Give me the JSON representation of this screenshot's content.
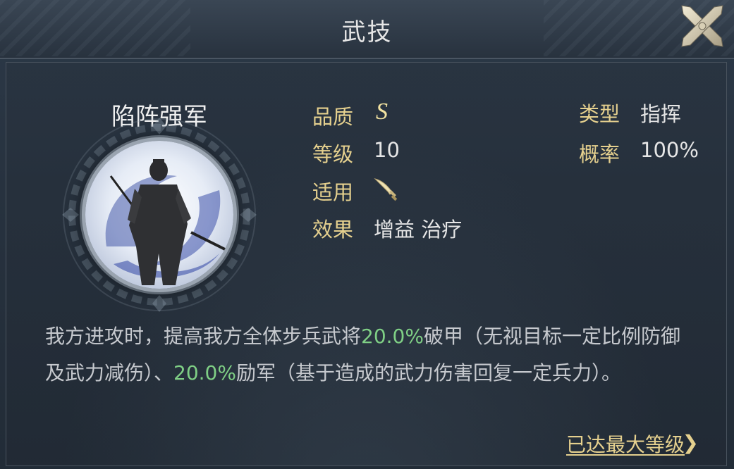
{
  "window": {
    "title": "武技"
  },
  "skill": {
    "name": "陷阵强军",
    "quality_label": "品质",
    "quality": "S",
    "level_label": "等级",
    "level": "10",
    "applies_label": "适用",
    "applies_icon": "sword-icon",
    "effect_label": "效果",
    "effect": "增益 治疗",
    "type_label": "类型",
    "type": "指挥",
    "rate_label": "概率",
    "rate": "100%"
  },
  "description": {
    "part1": "我方进攻时，提高我方全体步兵武将",
    "value1": "20.0%",
    "part2": "破甲（无视目标一定比例防御及武力减伤）、",
    "value2": "20.0%",
    "part3": "励军（基于造成的武力伤害回复一定兵力）。"
  },
  "footer": {
    "max_level_link": "已达最大等级"
  },
  "colors": {
    "label_gold": "#e5d08e",
    "highlight_green": "#7fcf85"
  }
}
